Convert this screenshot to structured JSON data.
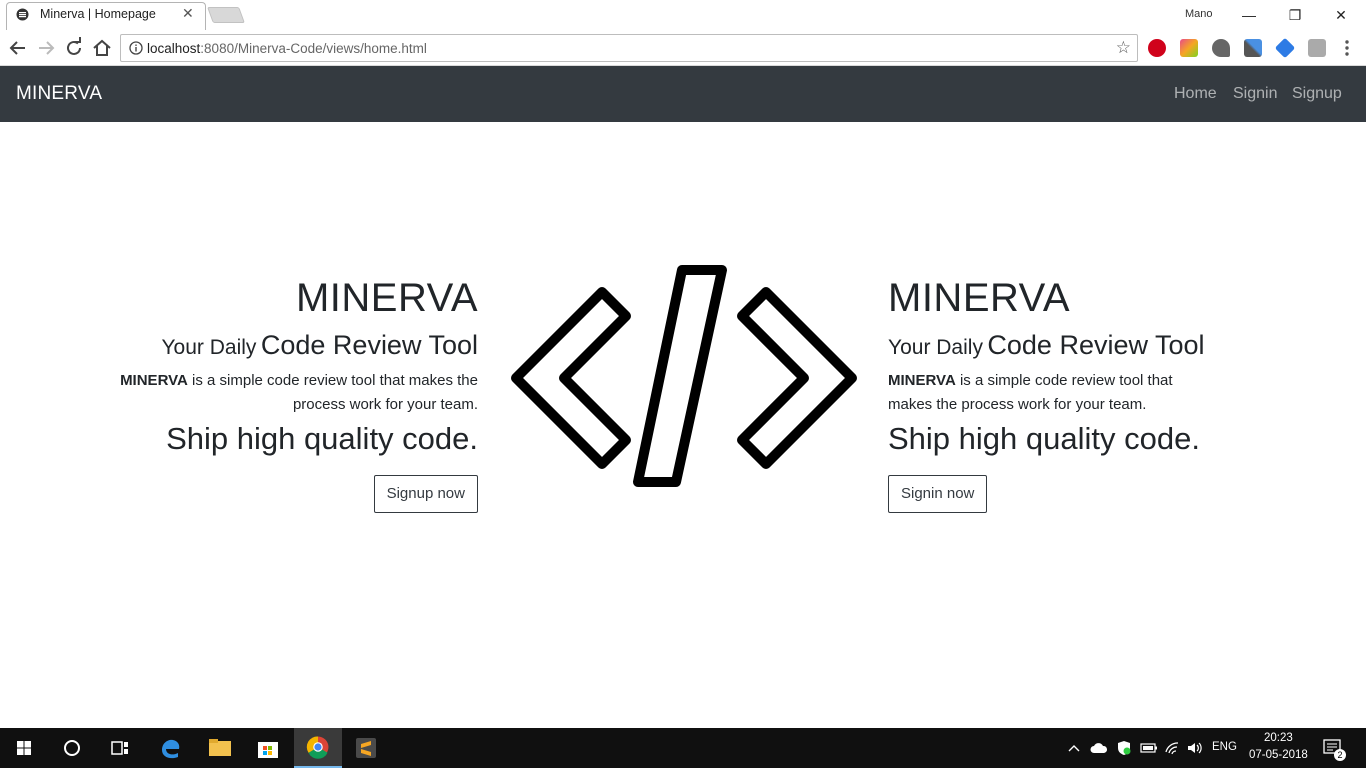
{
  "browser": {
    "tab_title": "Minerva | Homepage",
    "profile_name": "Mano",
    "url_host": "localhost",
    "url_rest": ":8080/Minerva-Code/views/home.html",
    "extensions": [
      "adblock-icon",
      "color-extension-icon",
      "brush-extension-icon",
      "eyedropper-icon",
      "tag-extension-icon",
      "cube-extension-icon"
    ]
  },
  "navbar": {
    "brand": "MINERVA",
    "links": [
      "Home",
      "Signin",
      "Signup"
    ]
  },
  "hero_left": {
    "title": "MINERVA",
    "subtitle_light": "Your Daily",
    "subtitle_bold": "Code Review Tool",
    "desc_bold": "MINERVA",
    "desc_rest": " is a simple code review tool that makes the process work for your team.",
    "ship": "Ship high quality code.",
    "button": "Signup now"
  },
  "hero_right": {
    "title": "MINERVA",
    "subtitle_light": "Your Daily",
    "subtitle_bold": "Code Review Tool",
    "desc_bold": "MINERVA",
    "desc_rest": " is a simple code review tool that makes the process work for your team.",
    "ship": "Ship high quality code.",
    "button": "Signin now"
  },
  "taskbar": {
    "language": "ENG",
    "time": "20:23",
    "date": "07-05-2018",
    "notification_count": "2"
  },
  "colors": {
    "navbar_bg": "#343a40",
    "taskbar_bg": "#101010"
  }
}
